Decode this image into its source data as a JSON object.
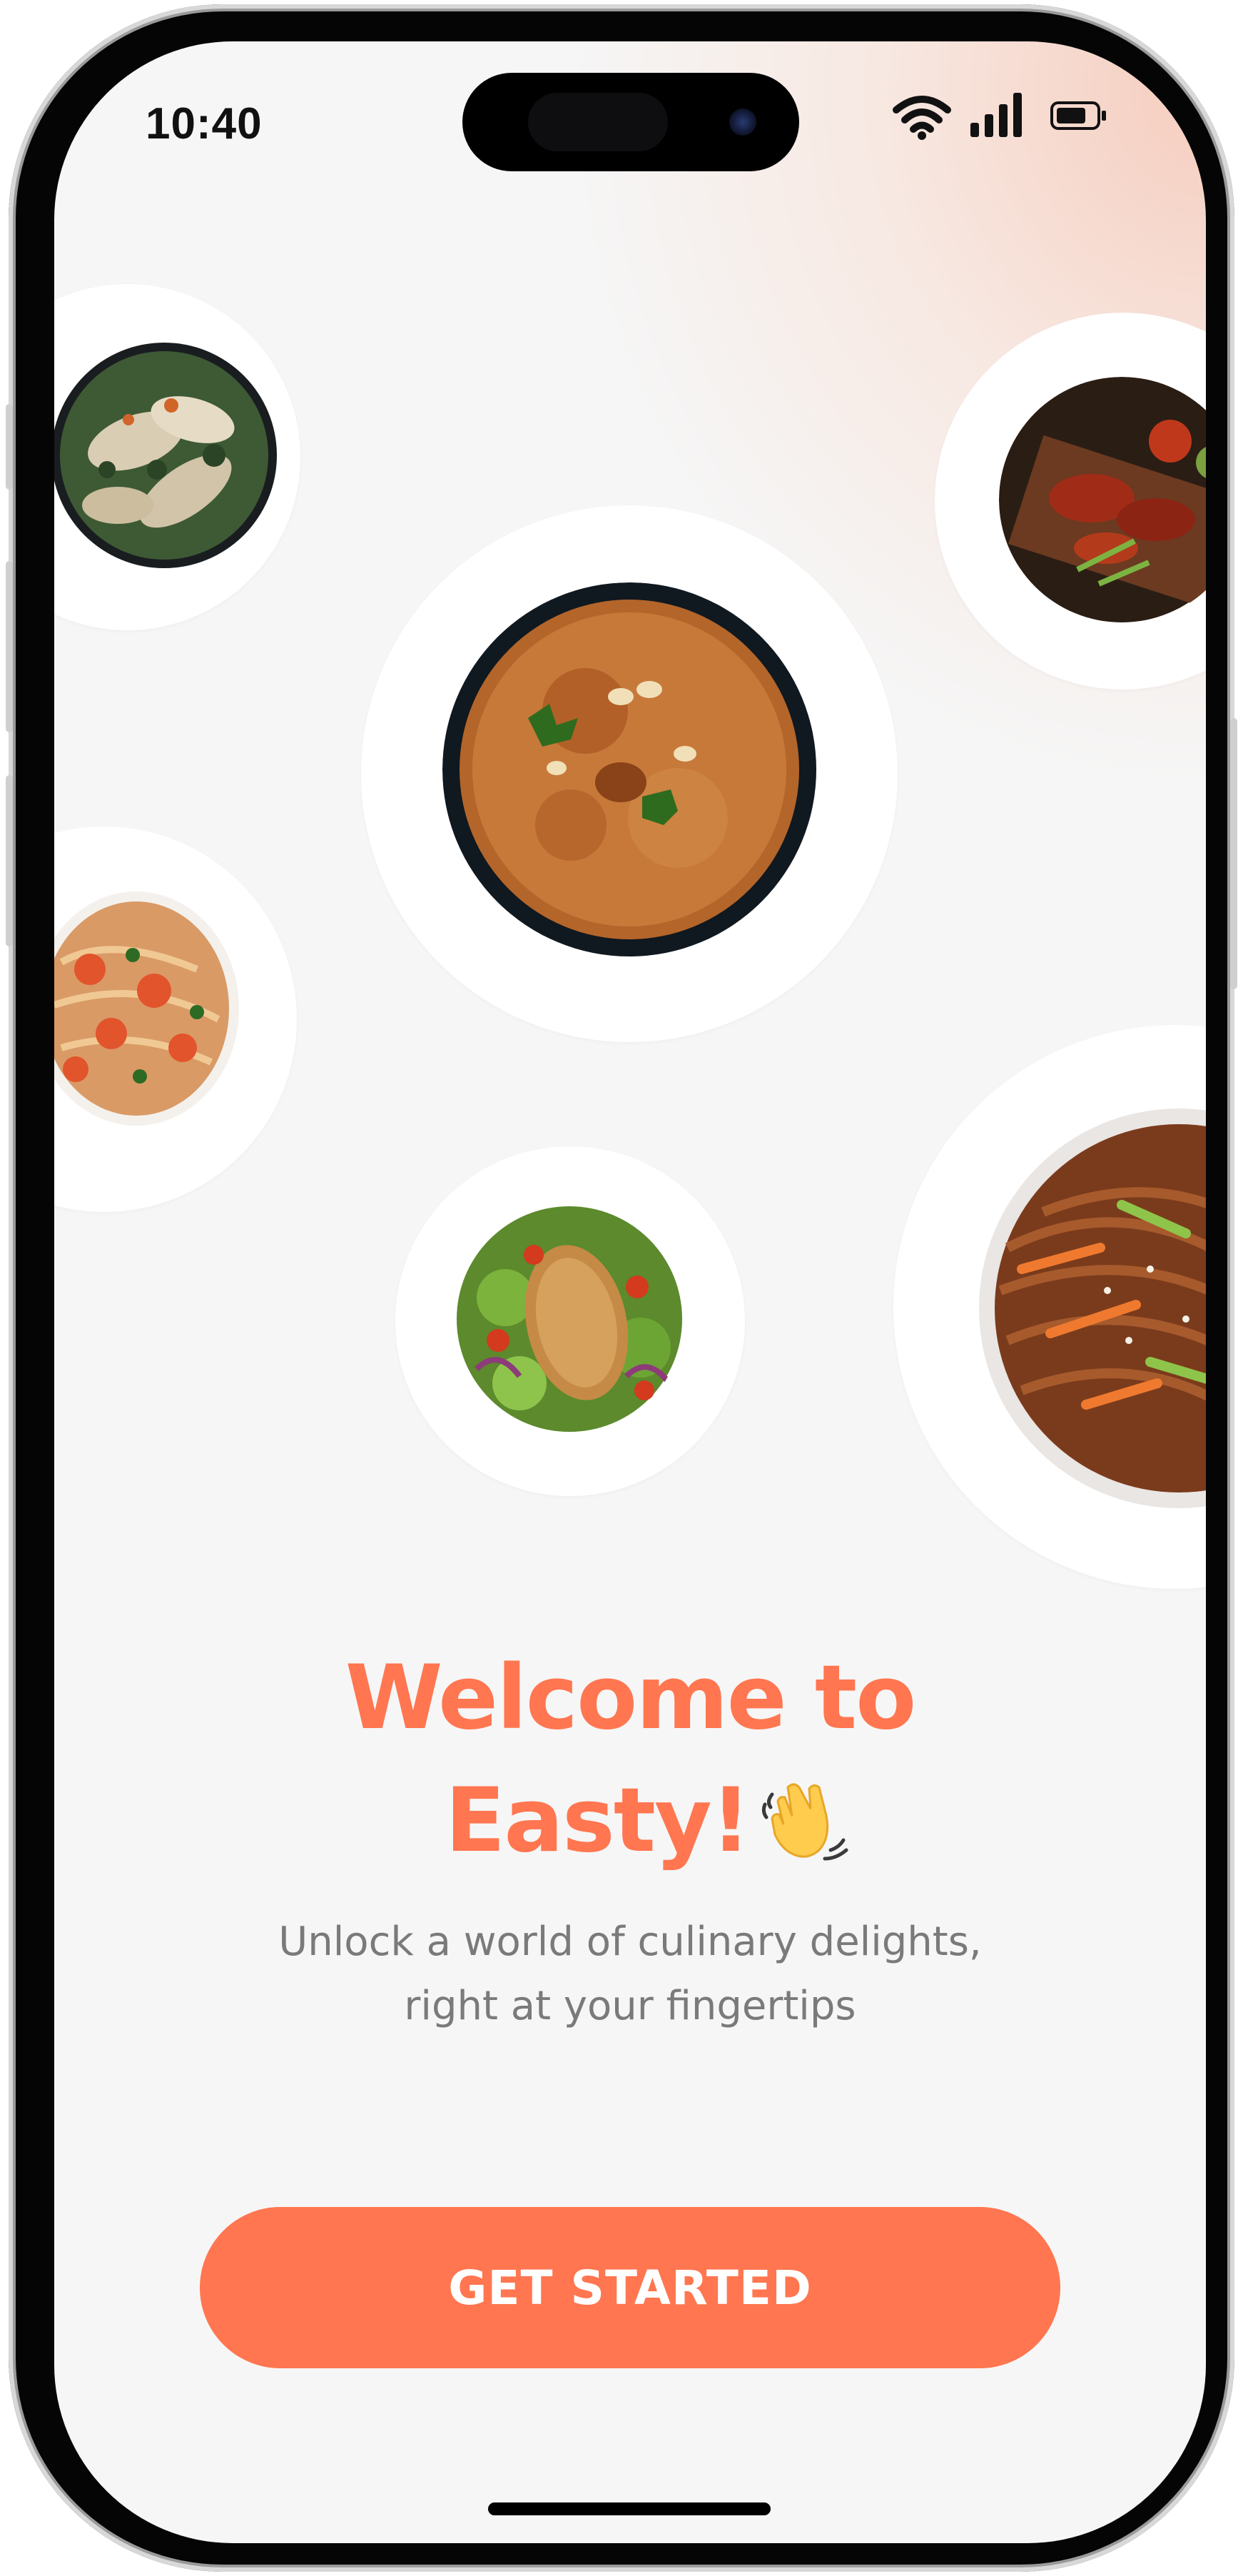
{
  "status_bar": {
    "time": "10:40",
    "icons": [
      "wifi-icon",
      "cellular-signal-icon",
      "battery-icon"
    ]
  },
  "dishes": [
    {
      "name": "spinach-fish-curry"
    },
    {
      "name": "chicken-biryani"
    },
    {
      "name": "tandoori-platter"
    },
    {
      "name": "shrimp-pasta"
    },
    {
      "name": "grilled-chicken-salad"
    },
    {
      "name": "vegetable-noodles"
    }
  ],
  "welcome": {
    "title_line1": "Welcome to",
    "title_line2": "Easty!",
    "emoji": "waving-hand-icon",
    "subtitle_line1": "Unlock a world of culinary delights,",
    "subtitle_line2": "right at your fingertips"
  },
  "cta": {
    "label": "GET STARTED"
  },
  "colors": {
    "accent": "#ff7650",
    "background": "#f6f6f6",
    "subtitle": "#7a7a7a",
    "glow": "#f6cbbc"
  }
}
